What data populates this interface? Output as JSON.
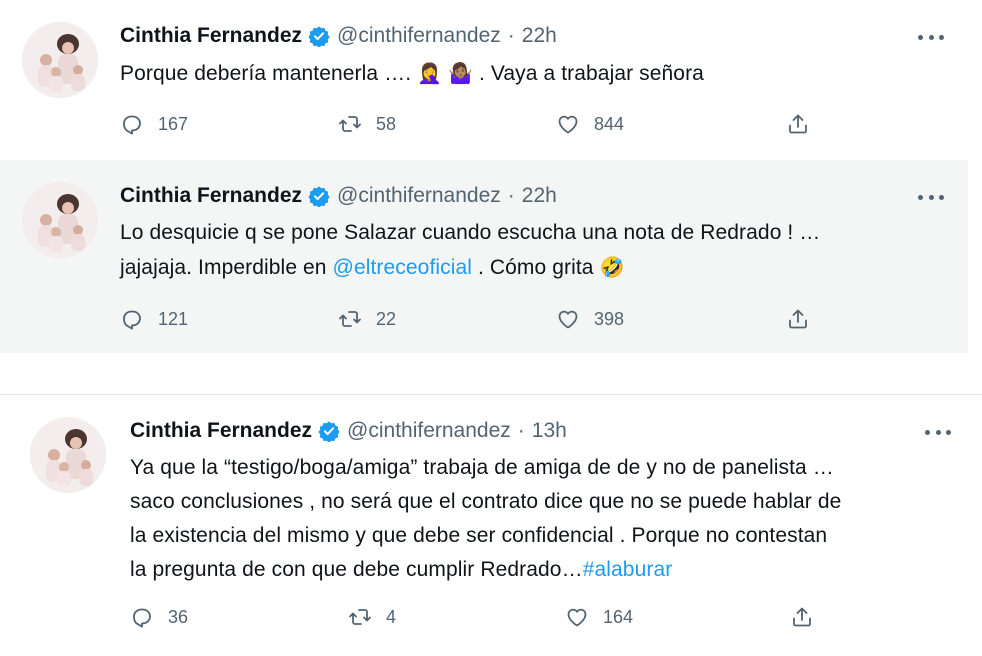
{
  "colors": {
    "link": "#1d9bf0",
    "verified": "#1d9bf0",
    "muted": "#536471",
    "highlight_bg": "#f4f5f5"
  },
  "icons": [
    "verified-badge-icon",
    "more-icon",
    "reply-icon",
    "retweet-icon",
    "like-icon",
    "share-icon"
  ],
  "tweets": [
    {
      "name": "Cinthia Fernandez",
      "handle": "@cinthifernandez",
      "separator": "·",
      "time": "22h",
      "text_1": "Porque debería mantenerla …. ",
      "emoji_1": "🤦‍♀️",
      "emoji_2": "🤷🏽‍♀️",
      "text_2": " . Vaya a trabajar señora",
      "replies": "167",
      "retweets": "58",
      "likes": "844"
    },
    {
      "name": "Cinthia Fernandez",
      "handle": "@cinthifernandez",
      "separator": "·",
      "time": "22h",
      "line_1": "Lo desquicie q se pone Salazar cuando escucha una nota de Redrado ! …",
      "line_2_a": "jajajaja. Imperdible en ",
      "mention": "@eltreceoficial",
      "line_2_b": " . Cómo grita ",
      "emoji": "🤣",
      "replies": "121",
      "retweets": "22",
      "likes": "398"
    },
    {
      "name": "Cinthia Fernandez",
      "handle": "@cinthifernandez",
      "separator": "·",
      "time": "13h",
      "line_1": "Ya que la “testigo/boga/amiga” trabaja de amiga de de y no de panelista …",
      "line_2": "saco conclusiones , no será que el contrato dice que no se puede hablar de",
      "line_3": "la existencia del mismo y que debe ser confidencial . Porque no contestan",
      "line_4": "la pregunta de con que debe cumplir Redrado…",
      "hashtag": "#alaburar",
      "replies": "36",
      "retweets": "4",
      "likes": "164"
    }
  ]
}
